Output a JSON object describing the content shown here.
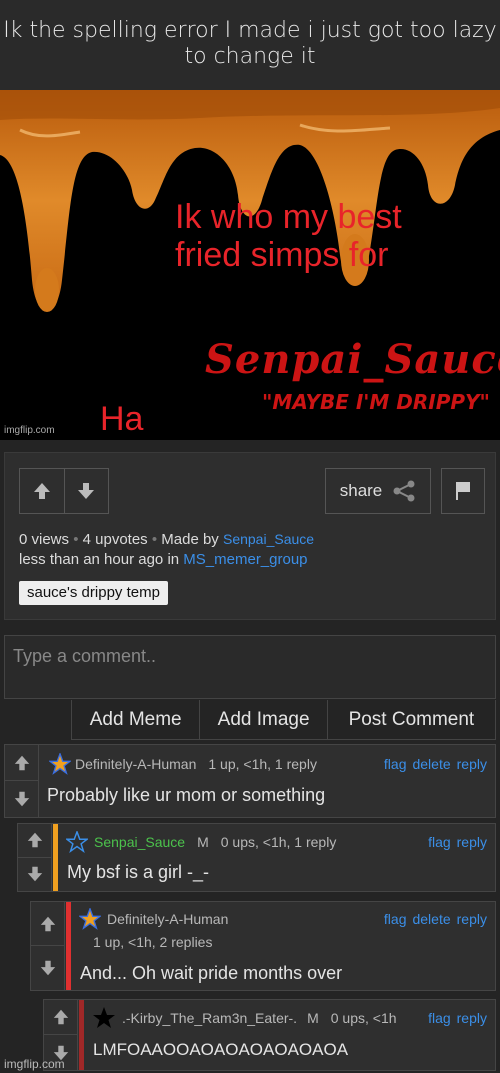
{
  "post": {
    "title": "Ik the spelling error I made i just got too lazy to change it"
  },
  "meme": {
    "line1": "Ik who my best fried simps for",
    "signature": "Senpai_Sauce",
    "subtitle": "\"MAYBE I'M DRIPPY\"",
    "ha": "Ha",
    "watermark": "imgflip.com",
    "drip_color": "#d97a1a"
  },
  "toolbar": {
    "share_label": "share",
    "upvote_icon": "arrow-up-icon",
    "downvote_icon": "arrow-down-icon",
    "share_icon": "share-icon",
    "flag_icon": "flag-icon"
  },
  "stats": {
    "views": "0 views",
    "upvotes": "4 upvotes",
    "made_by_label": "Made by",
    "author": "Senpai_Sauce",
    "time": "less than an hour ago in",
    "stream": "MS_memer_group",
    "tag": "sauce's drippy temp"
  },
  "composer": {
    "placeholder": "Type a comment..",
    "add_meme": "Add Meme",
    "add_image": "Add Image",
    "post_comment": "Post Comment"
  },
  "comments": [
    {
      "user": "Definitely-A-Human",
      "meta": "1 up, <1h, 1 reply",
      "text": "Probably like ur mom or something",
      "flag": "flag",
      "delete": "delete",
      "reply": "reply"
    },
    {
      "user": "Senpai_Sauce",
      "badge": "M",
      "meta": "0 ups, <1h, 1 reply",
      "text": "My bsf is a girl -_-",
      "flag": "flag",
      "reply": "reply",
      "bar_color": "#f0a020"
    },
    {
      "user": "Definitely-A-Human",
      "meta": "1 up, <1h, 2 replies",
      "text": "And... Oh wait pride months over",
      "flag": "flag",
      "delete": "delete",
      "reply": "reply",
      "bar_color": "#e03030"
    },
    {
      "user": ".-Kirby_The_Ram3n_Eater-.",
      "badge": "M",
      "meta": "0 ups, <1h",
      "text": "LMFOAAOOAOAOAOAOAOAOA",
      "flag": "flag",
      "reply": "reply",
      "bar_color": "#a02828"
    }
  ],
  "footer": {
    "watermark": "imgflip.com"
  }
}
